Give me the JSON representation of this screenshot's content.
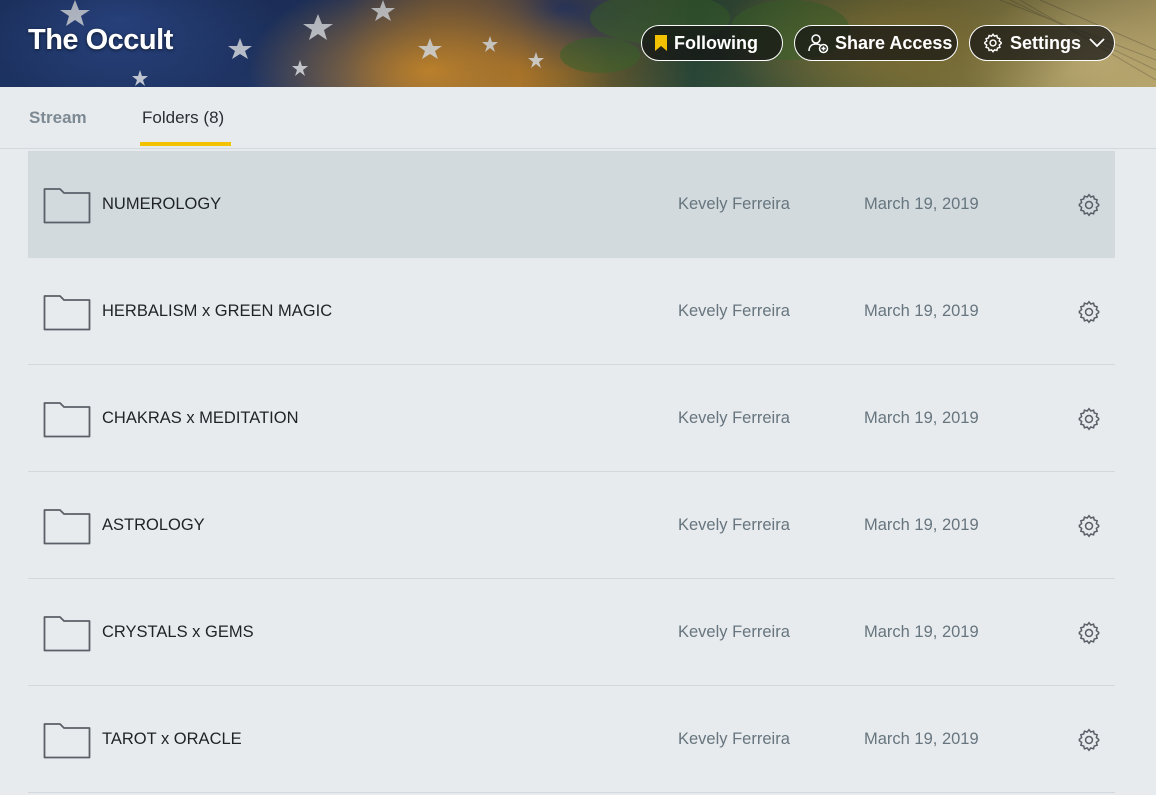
{
  "header": {
    "title": "The Occult",
    "following_label": "Following",
    "share_label": "Share Access",
    "settings_label": "Settings"
  },
  "tabs": [
    {
      "label": "Stream",
      "active": false
    },
    {
      "label": "Folders (8)",
      "active": true
    }
  ],
  "folders": [
    {
      "name": "NUMEROLOGY",
      "owner": "Kevely Ferreira",
      "date": "March 19, 2019"
    },
    {
      "name": "HERBALISM x GREEN MAGIC",
      "owner": "Kevely Ferreira",
      "date": "March 19, 2019"
    },
    {
      "name": "CHAKRAS x MEDITATION",
      "owner": "Kevely Ferreira",
      "date": "March 19, 2019"
    },
    {
      "name": "ASTROLOGY",
      "owner": "Kevely Ferreira",
      "date": "March 19, 2019"
    },
    {
      "name": "CRYSTALS x GEMS",
      "owner": "Kevely Ferreira",
      "date": "March 19, 2019"
    },
    {
      "name": "TAROT x ORACLE",
      "owner": "Kevely Ferreira",
      "date": "March 19, 2019"
    }
  ],
  "colors": {
    "accent_underline": "#f2c100",
    "following_icon": "#f2c100",
    "page_bg": "#e8ebee",
    "row_hover_bg": "#d2dade"
  },
  "icons": {
    "following": "bookmark-icon",
    "share": "user-add-icon",
    "settings": "gear-icon",
    "dropdown": "chevron-down-icon",
    "folder": "folder-icon",
    "row_settings": "gear-icon"
  }
}
